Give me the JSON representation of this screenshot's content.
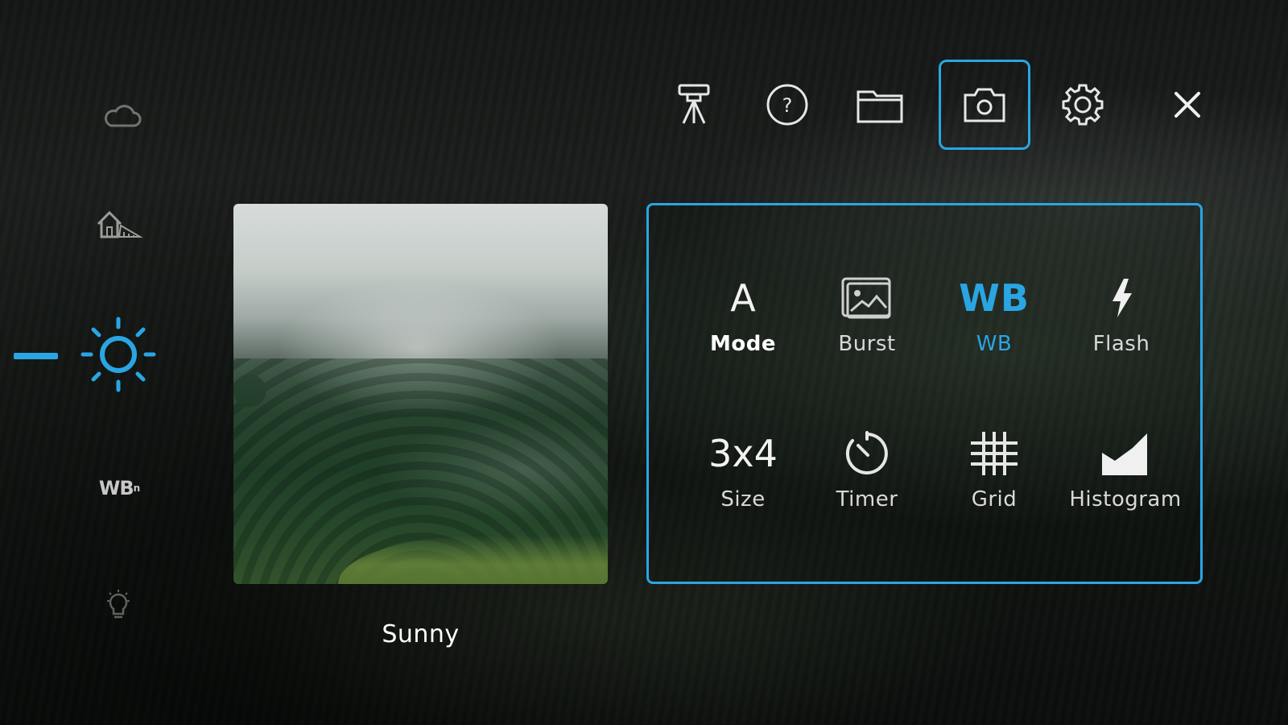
{
  "colors": {
    "accent": "#2aa5e3",
    "text": "#ffffff",
    "muted": "#d9d9d9"
  },
  "rail": {
    "items": [
      {
        "icon": "cloud-icon"
      },
      {
        "icon": "home-shade-icon"
      },
      {
        "icon": "sun-icon",
        "selected": true
      },
      {
        "label_main": "WB",
        "label_sub": "n",
        "icon": "wb-preset-icon"
      },
      {
        "icon": "bulb-icon"
      }
    ]
  },
  "preview": {
    "caption": "Sunny"
  },
  "toolbar": {
    "items": [
      "tripod-icon",
      "help-icon",
      "folder-icon",
      "camera-icon",
      "gear-icon",
      "close-icon"
    ],
    "help_glyph": "?",
    "selected": "camera-icon"
  },
  "panel": {
    "cells": [
      {
        "label": "Mode",
        "glyph": "A"
      },
      {
        "label": "Burst"
      },
      {
        "label": "WB",
        "glyph": "WB",
        "active": true
      },
      {
        "label": "Flash"
      },
      {
        "label": "Size",
        "glyph": "3x4"
      },
      {
        "label": "Timer"
      },
      {
        "label": "Grid"
      },
      {
        "label": "Histogram"
      }
    ]
  }
}
